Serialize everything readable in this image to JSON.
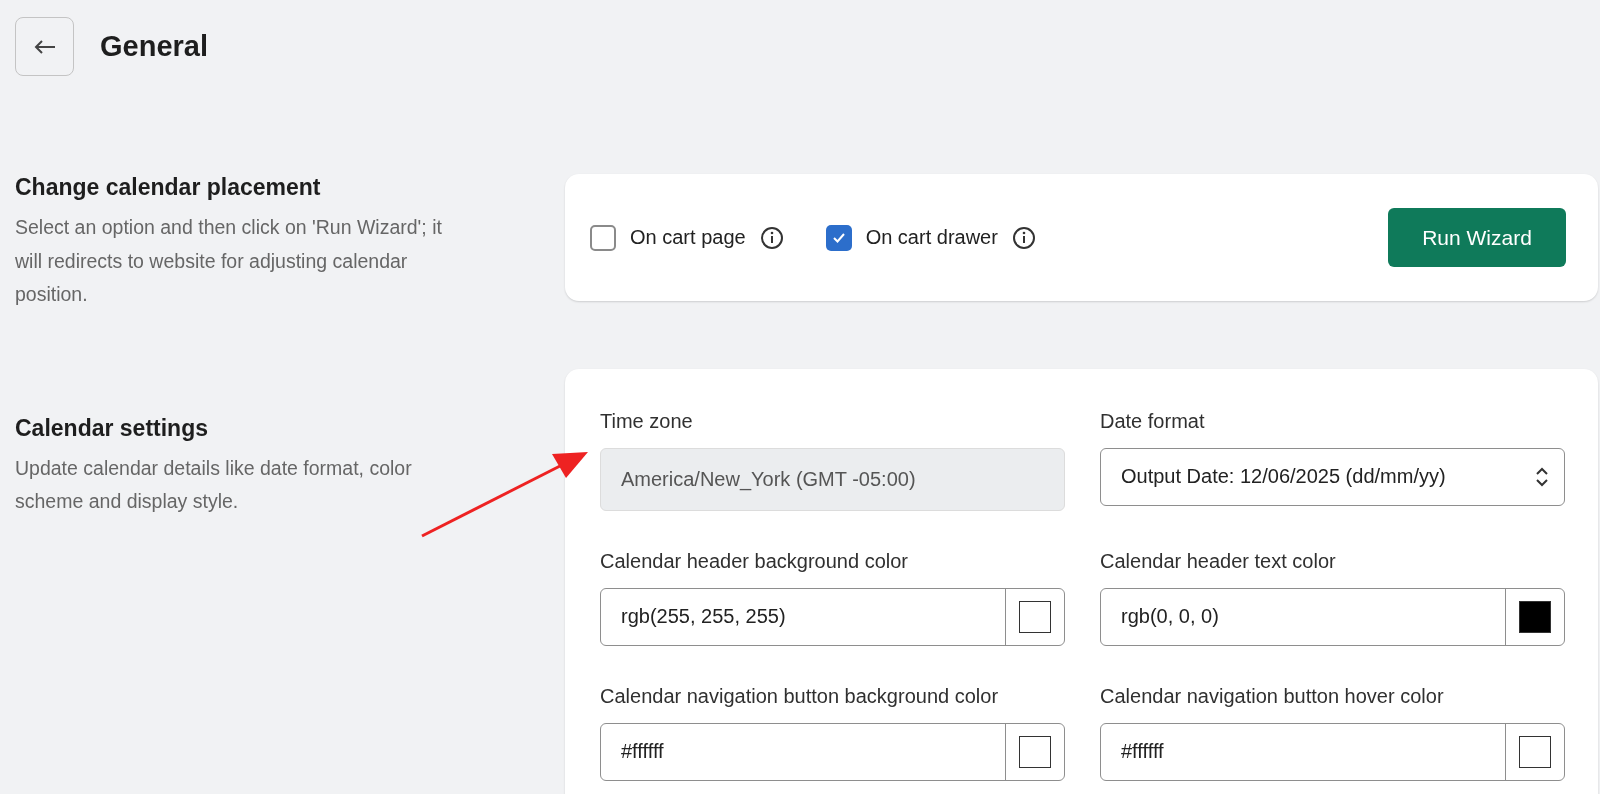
{
  "header": {
    "title": "General"
  },
  "sections": [
    {
      "heading": "Change calendar placement",
      "description": "Select an option and then click on 'Run Wizard'; it will redirects to website for adjusting calendar position.",
      "kind": "placement",
      "options": [
        {
          "label": "On cart page",
          "checked": false
        },
        {
          "label": "On cart drawer",
          "checked": true
        }
      ],
      "button": "Run Wizard"
    },
    {
      "heading": "Calendar settings",
      "description": "Update calendar details like date format, color scheme and display style.",
      "kind": "settings",
      "fields": [
        {
          "kind": "text",
          "label": "Time zone",
          "value": "America/New_York (GMT -05:00)",
          "disabled": true
        },
        {
          "kind": "select",
          "label": "Date format",
          "value": "Output Date: 12/06/2025 (dd/mm/yy)"
        },
        {
          "kind": "color",
          "label": "Calendar header background color",
          "value": "rgb(255, 255, 255)",
          "color": "#ffffff"
        },
        {
          "kind": "color",
          "label": "Calendar header text color",
          "value": "rgb(0, 0, 0)",
          "color": "#000000"
        },
        {
          "kind": "color",
          "label": "Calendar navigation button background color",
          "value": "#ffffff",
          "color": "#ffffff"
        },
        {
          "kind": "color",
          "label": "Calendar navigation button hover color",
          "value": "#ffffff",
          "color": "#ffffff"
        }
      ]
    }
  ],
  "annotation": {
    "kind": "arrow",
    "color": "#ee2222"
  }
}
